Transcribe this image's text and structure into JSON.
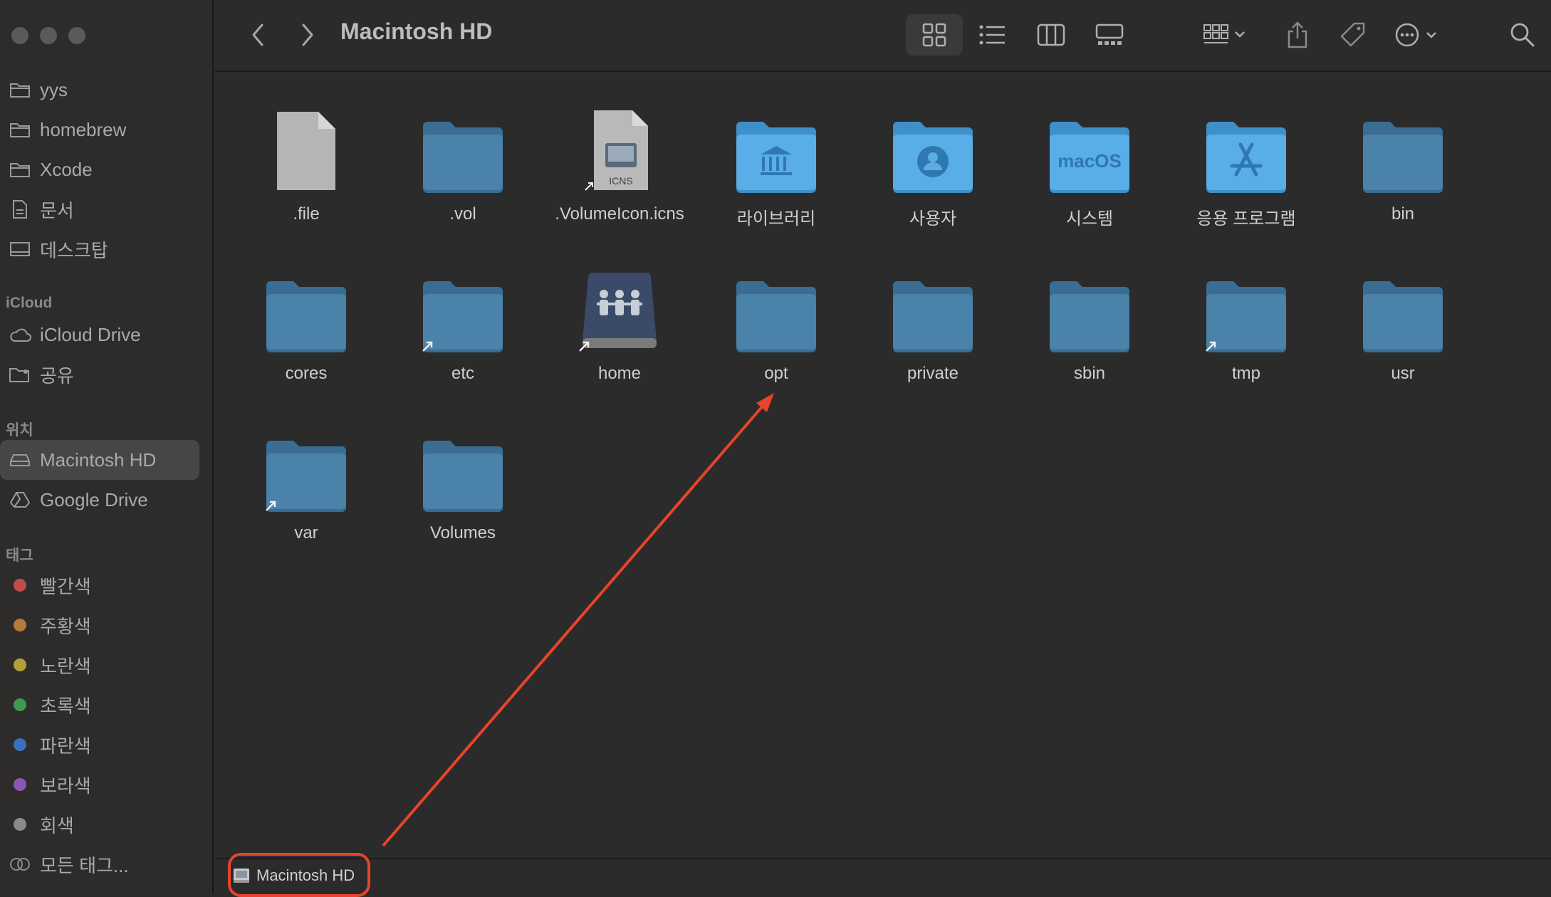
{
  "window": {
    "title": "Macintosh HD"
  },
  "sidebar": {
    "favorites": [
      {
        "label": "yys",
        "icon": "folder-icon"
      },
      {
        "label": "homebrew",
        "icon": "folder-icon"
      },
      {
        "label": "Xcode",
        "icon": "folder-icon"
      },
      {
        "label": "문서",
        "icon": "document-icon"
      },
      {
        "label": "데스크탑",
        "icon": "desktop-icon"
      }
    ],
    "icloud_header": "iCloud",
    "icloud": [
      {
        "label": "iCloud Drive",
        "icon": "cloud-icon"
      },
      {
        "label": "공유",
        "icon": "shared-folder-icon"
      }
    ],
    "locations_header": "위치",
    "locations": [
      {
        "label": "Macintosh HD",
        "icon": "drive-icon",
        "selected": true
      },
      {
        "label": "Google Drive",
        "icon": "google-drive-icon"
      }
    ],
    "tags_header": "태그",
    "tags": [
      {
        "label": "빨간색",
        "color": "#c14c4c"
      },
      {
        "label": "주황색",
        "color": "#b77a3a"
      },
      {
        "label": "노란색",
        "color": "#b3a03c"
      },
      {
        "label": "초록색",
        "color": "#3e9a4e"
      },
      {
        "label": "파란색",
        "color": "#3c6fbf"
      },
      {
        "label": "보라색",
        "color": "#8e55b0"
      },
      {
        "label": "회색",
        "color": "#8a8a8a"
      },
      {
        "label": "모든 태그...",
        "color": "all"
      }
    ]
  },
  "toolbar": {
    "title": "Macintosh HD",
    "buttons": [
      "back-icon",
      "forward-icon",
      "icon-view-icon",
      "list-view-icon",
      "column-view-icon",
      "gallery-view-icon",
      "group-icon",
      "share-icon",
      "tag-icon",
      "more-icon",
      "search-icon"
    ]
  },
  "files": [
    {
      "name": ".file",
      "type": "file"
    },
    {
      "name": ".vol",
      "type": "folder"
    },
    {
      "name": ".VolumeIcon.icns",
      "type": "icns",
      "badge": "ICNS",
      "alias": true
    },
    {
      "name": "라이브러리",
      "type": "library-folder"
    },
    {
      "name": "사용자",
      "type": "users-folder"
    },
    {
      "name": "시스템",
      "type": "system-folder",
      "badge": "macOS"
    },
    {
      "name": "응용 프로그램",
      "type": "apps-folder"
    },
    {
      "name": "bin",
      "type": "folder"
    },
    {
      "name": "cores",
      "type": "folder"
    },
    {
      "name": "etc",
      "type": "folder",
      "alias": true
    },
    {
      "name": "home",
      "type": "home-drive",
      "alias": true
    },
    {
      "name": "opt",
      "type": "folder"
    },
    {
      "name": "private",
      "type": "folder"
    },
    {
      "name": "sbin",
      "type": "folder"
    },
    {
      "name": "tmp",
      "type": "folder",
      "alias": true
    },
    {
      "name": "usr",
      "type": "folder"
    },
    {
      "name": "var",
      "type": "folder",
      "alias": true
    },
    {
      "name": "Volumes",
      "type": "folder"
    }
  ],
  "pathbar": {
    "label": "Macintosh HD"
  },
  "annotation": {
    "color": "#e8442a"
  }
}
